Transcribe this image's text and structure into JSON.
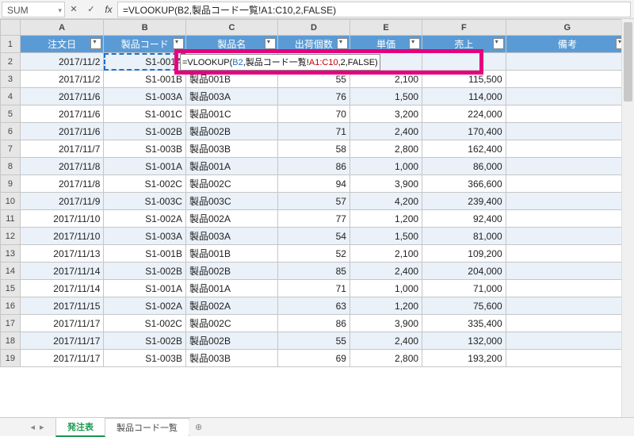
{
  "namebox": "SUM",
  "formula_bar": "=VLOOKUP(B2,製品コード一覧!A1:C10,2,FALSE)",
  "cell_formula": {
    "prefix": "=VLOOKUP(",
    "ref1": "B2",
    "mid": ",製品コード一覧!",
    "ref2": "A1:C10",
    "suffix": ",2,FALSE)"
  },
  "columns": [
    "A",
    "B",
    "C",
    "D",
    "E",
    "F",
    "G"
  ],
  "headers": [
    "注文日",
    "製品コード",
    "製品名",
    "出荷個数",
    "単価",
    "売上",
    "備考"
  ],
  "rows": [
    {
      "n": 2,
      "A": "2017/11/2",
      "B": "S1-001A",
      "C": "",
      "D": "",
      "E": "",
      "F": "",
      "G": ""
    },
    {
      "n": 3,
      "A": "2017/11/2",
      "B": "S1-001B",
      "C": "製品001B",
      "D": "55",
      "E": "2,100",
      "F": "115,500",
      "G": ""
    },
    {
      "n": 4,
      "A": "2017/11/6",
      "B": "S1-003A",
      "C": "製品003A",
      "D": "76",
      "E": "1,500",
      "F": "114,000",
      "G": ""
    },
    {
      "n": 5,
      "A": "2017/11/6",
      "B": "S1-001C",
      "C": "製品001C",
      "D": "70",
      "E": "3,200",
      "F": "224,000",
      "G": ""
    },
    {
      "n": 6,
      "A": "2017/11/6",
      "B": "S1-002B",
      "C": "製品002B",
      "D": "71",
      "E": "2,400",
      "F": "170,400",
      "G": ""
    },
    {
      "n": 7,
      "A": "2017/11/7",
      "B": "S1-003B",
      "C": "製品003B",
      "D": "58",
      "E": "2,800",
      "F": "162,400",
      "G": ""
    },
    {
      "n": 8,
      "A": "2017/11/8",
      "B": "S1-001A",
      "C": "製品001A",
      "D": "86",
      "E": "1,000",
      "F": "86,000",
      "G": ""
    },
    {
      "n": 9,
      "A": "2017/11/8",
      "B": "S1-002C",
      "C": "製品002C",
      "D": "94",
      "E": "3,900",
      "F": "366,600",
      "G": ""
    },
    {
      "n": 10,
      "A": "2017/11/9",
      "B": "S1-003C",
      "C": "製品003C",
      "D": "57",
      "E": "4,200",
      "F": "239,400",
      "G": ""
    },
    {
      "n": 11,
      "A": "2017/11/10",
      "B": "S1-002A",
      "C": "製品002A",
      "D": "77",
      "E": "1,200",
      "F": "92,400",
      "G": ""
    },
    {
      "n": 12,
      "A": "2017/11/10",
      "B": "S1-003A",
      "C": "製品003A",
      "D": "54",
      "E": "1,500",
      "F": "81,000",
      "G": ""
    },
    {
      "n": 13,
      "A": "2017/11/13",
      "B": "S1-001B",
      "C": "製品001B",
      "D": "52",
      "E": "2,100",
      "F": "109,200",
      "G": ""
    },
    {
      "n": 14,
      "A": "2017/11/14",
      "B": "S1-002B",
      "C": "製品002B",
      "D": "85",
      "E": "2,400",
      "F": "204,000",
      "G": ""
    },
    {
      "n": 15,
      "A": "2017/11/14",
      "B": "S1-001A",
      "C": "製品001A",
      "D": "71",
      "E": "1,000",
      "F": "71,000",
      "G": ""
    },
    {
      "n": 16,
      "A": "2017/11/15",
      "B": "S1-002A",
      "C": "製品002A",
      "D": "63",
      "E": "1,200",
      "F": "75,600",
      "G": ""
    },
    {
      "n": 17,
      "A": "2017/11/17",
      "B": "S1-002C",
      "C": "製品002C",
      "D": "86",
      "E": "3,900",
      "F": "335,400",
      "G": ""
    },
    {
      "n": 18,
      "A": "2017/11/17",
      "B": "S1-002B",
      "C": "製品002B",
      "D": "55",
      "E": "2,400",
      "F": "132,000",
      "G": ""
    },
    {
      "n": 19,
      "A": "2017/11/17",
      "B": "S1-003B",
      "C": "製品003B",
      "D": "69",
      "E": "2,800",
      "F": "193,200",
      "G": ""
    }
  ],
  "tabs": {
    "active": "発注表",
    "other": "製品コード一覧"
  }
}
